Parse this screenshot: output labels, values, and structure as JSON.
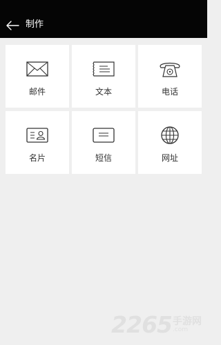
{
  "header": {
    "title": "制作",
    "back_icon": "arrow-left-icon"
  },
  "tiles": [
    {
      "label": "邮件",
      "icon": "envelope-icon"
    },
    {
      "label": "文本",
      "icon": "text-note-icon"
    },
    {
      "label": "电话",
      "icon": "telephone-icon"
    },
    {
      "label": "名片",
      "icon": "contact-card-icon"
    },
    {
      "label": "短信",
      "icon": "sms-message-icon"
    },
    {
      "label": "网址",
      "icon": "globe-icon"
    }
  ],
  "watermark": {
    "number": "2265",
    "text": "手游网",
    "sub": ".com"
  },
  "colors": {
    "header_bg": "#050505",
    "page_bg": "#efefef",
    "tile_bg": "#ffffff"
  }
}
